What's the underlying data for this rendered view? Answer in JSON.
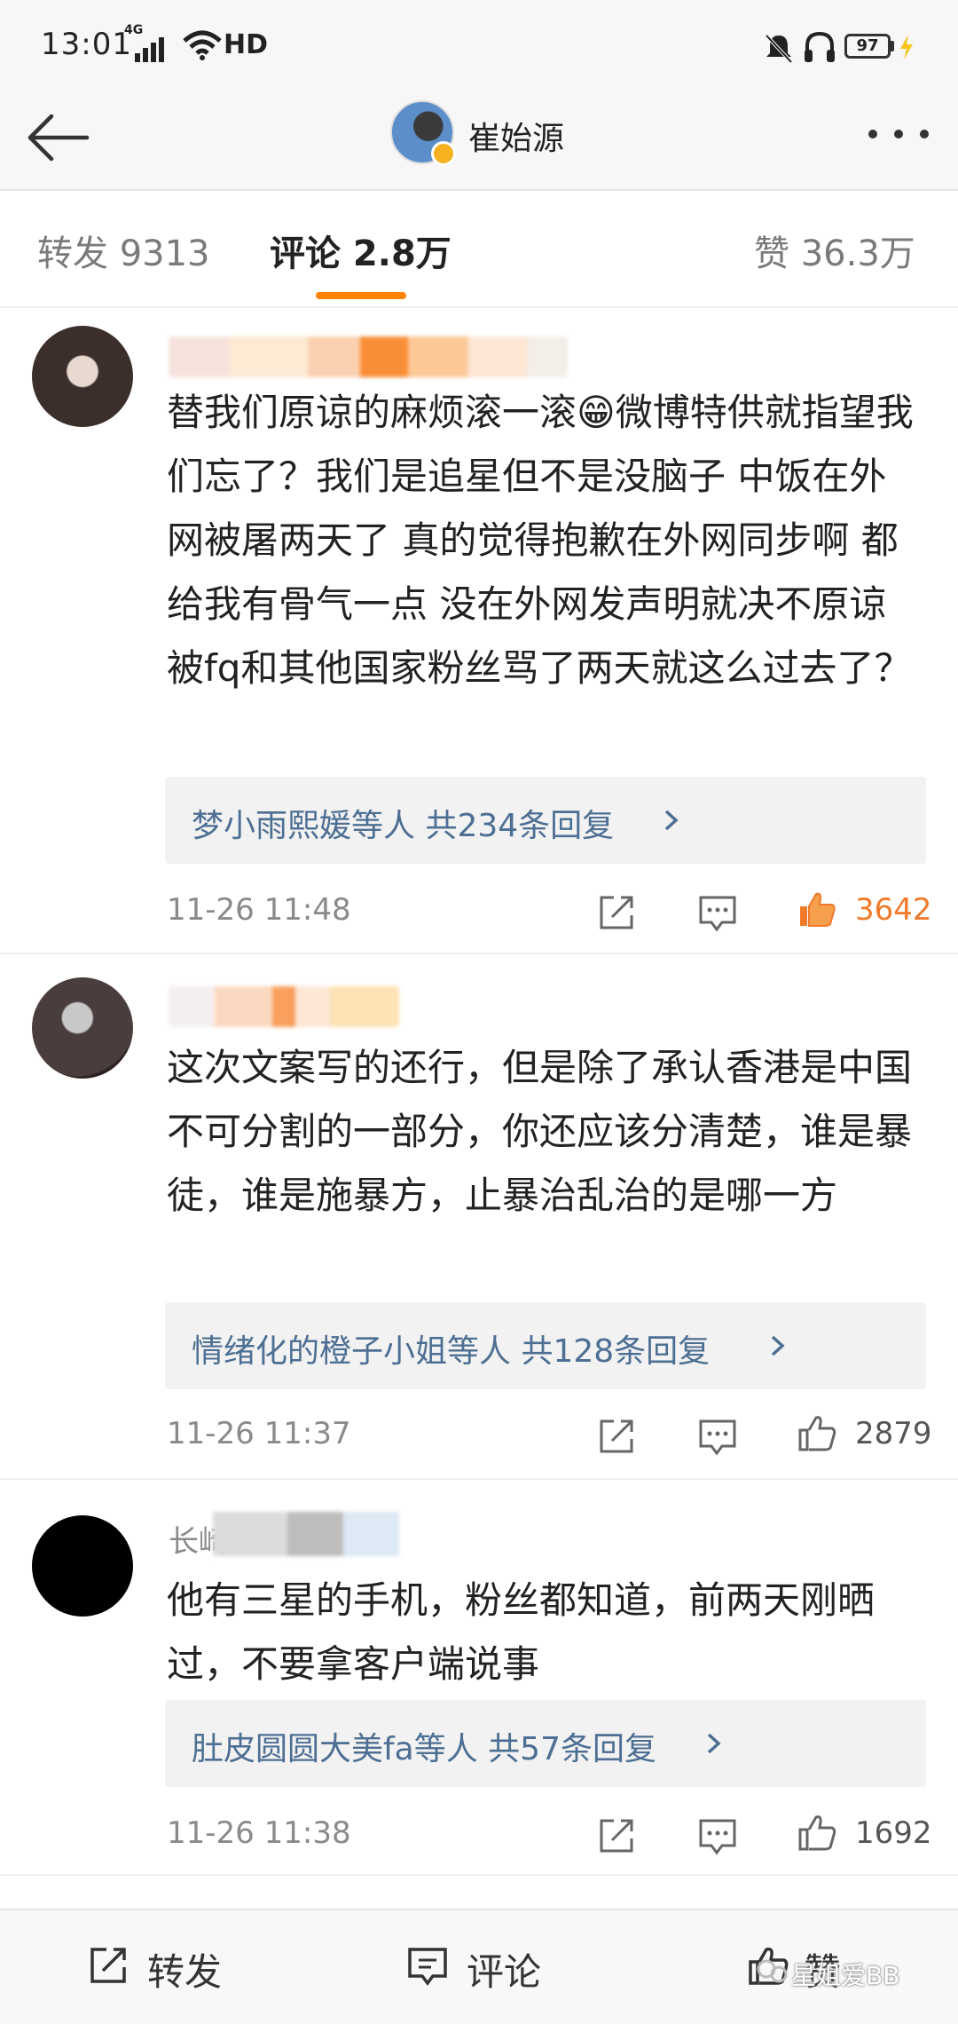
{
  "status_bar": {
    "time": "13:01",
    "network": "4G",
    "hd": "HD",
    "battery": "97"
  },
  "header": {
    "title": "崔始源"
  },
  "tabs": {
    "repost": "转发 9313",
    "comment": "评论 2.8万",
    "like": "赞 36.3万"
  },
  "comments": [
    {
      "text": "替我们原谅的麻烦滚一滚😁微博特供就指望我们忘了？我们是追星但不是没脑子 中饭在外网被屠两天了 真的觉得抱歉在外网同步啊 都给我有骨气一点 没在外网发声明就决不原谅 被fq和其他国家粉丝骂了两天就这么过去了？",
      "reply_summary": "梦小雨熙媛等人  共234条回复",
      "time": "11-26 11:48",
      "likes": "3642",
      "liked": true
    },
    {
      "text": "这次文案写的还行，但是除了承认香港是中国不可分割的一部分，你还应该分清楚，谁是暴徒，谁是施暴方，止暴治乱治的是哪一方",
      "reply_summary": "情绪化的橙子小姐等人  共128条回复",
      "time": "11-26 11:37",
      "likes": "2879",
      "liked": false
    },
    {
      "name_prefix": "长崎",
      "text": "他有三星的手机，粉丝都知道，前两天刚晒过，不要拿客户端说事",
      "reply_summary": "肚皮圆圆大美fa等人  共57条回复",
      "time": "11-26 11:38",
      "likes": "1692",
      "liked": false
    }
  ],
  "bottom_bar": {
    "repost": "转发",
    "comment": "评论",
    "like": "赞",
    "watermark": "星姐爱BB"
  },
  "colors": {
    "accent": "#ff8200",
    "link": "#4d6f93",
    "liked": "#f07a2a"
  }
}
